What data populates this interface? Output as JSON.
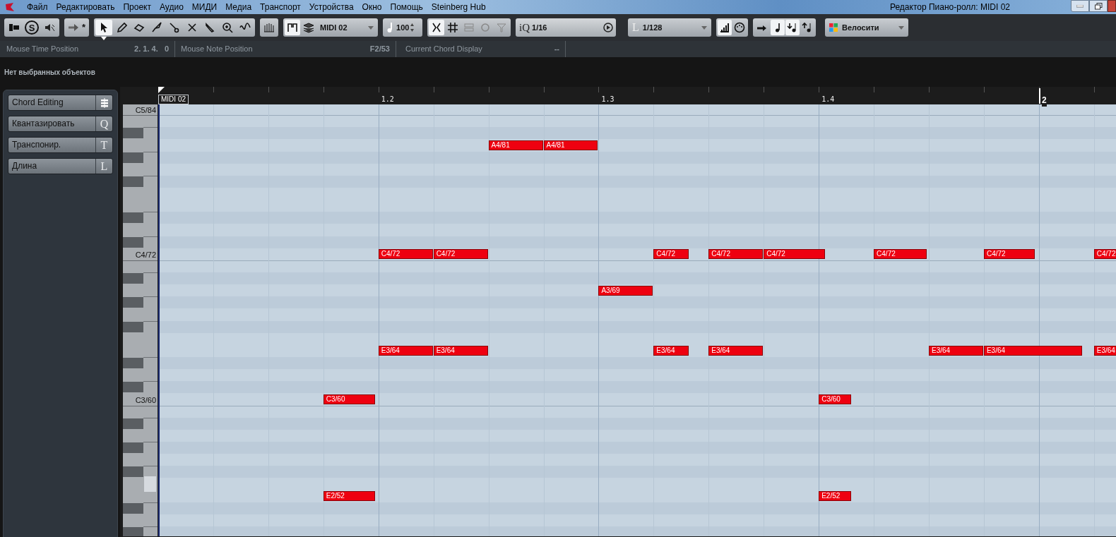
{
  "window": {
    "title": "Редактор Пиано-ролл: MIDI 02"
  },
  "menu": [
    "Файл",
    "Редактировать",
    "Проект",
    "Аудио",
    "МИДИ",
    "Медиа",
    "Транспорт",
    "Устройства",
    "Окно",
    "Помощь",
    "Steinberg Hub"
  ],
  "toolbar": {
    "solo_label": "S",
    "autoscroll_suffix": "*",
    "tools": [
      {
        "kind": "pointer",
        "selected": true
      },
      {
        "kind": "pencil",
        "selected": false
      },
      {
        "kind": "eraser",
        "selected": false
      },
      {
        "kind": "knife",
        "selected": false
      },
      {
        "kind": "scissors",
        "selected": false
      },
      {
        "kind": "mute",
        "selected": false
      },
      {
        "kind": "brush",
        "selected": false
      },
      {
        "kind": "zoom",
        "selected": false
      },
      {
        "kind": "line",
        "selected": false
      }
    ],
    "part": "MIDI 02",
    "insert_velocity": "100",
    "quantize_prefix": "iQ",
    "quantize": "1/16",
    "length_prefix": "L",
    "length": "1/128",
    "controller": "Велосити"
  },
  "info_line": [
    {
      "label": "Mouse Time Position",
      "value": "2. 1. 4.   0"
    },
    {
      "label": "Mouse Note Position",
      "value": "F2/53"
    },
    {
      "label": "Current Chord Display",
      "value": "--"
    }
  ],
  "status": "Нет выбранных объектов",
  "inspector": [
    {
      "label": "Chord Editing",
      "kind": "icon"
    },
    {
      "label": "Квантазировать",
      "key": "Q",
      "kind": "letter"
    },
    {
      "label": "Транспонир.",
      "key": "T",
      "kind": "letter"
    },
    {
      "label": "Длина",
      "key": "L",
      "kind": "letter"
    }
  ],
  "ruler": {
    "event": "MIDI 02",
    "marks": [
      "1.2",
      "1.3",
      "1.4",
      "2"
    ]
  },
  "keyboard": {
    "labels": [
      "C5/84",
      "C4/72",
      "C3/60"
    ],
    "pressed_key": true
  },
  "notes": [
    "A4/81",
    "A4/81",
    "C4/72",
    "C4/72",
    "C4/72",
    "C4/72",
    "C4/72",
    "C4/72",
    "C4/72",
    "C4/72",
    "A3/69",
    "E3/64",
    "E3/64",
    "E3/64",
    "E3/64",
    "E3/64",
    "E3/64",
    "E3/64",
    "C3/60",
    "C3/60",
    "E2/52",
    "E2/52"
  ]
}
